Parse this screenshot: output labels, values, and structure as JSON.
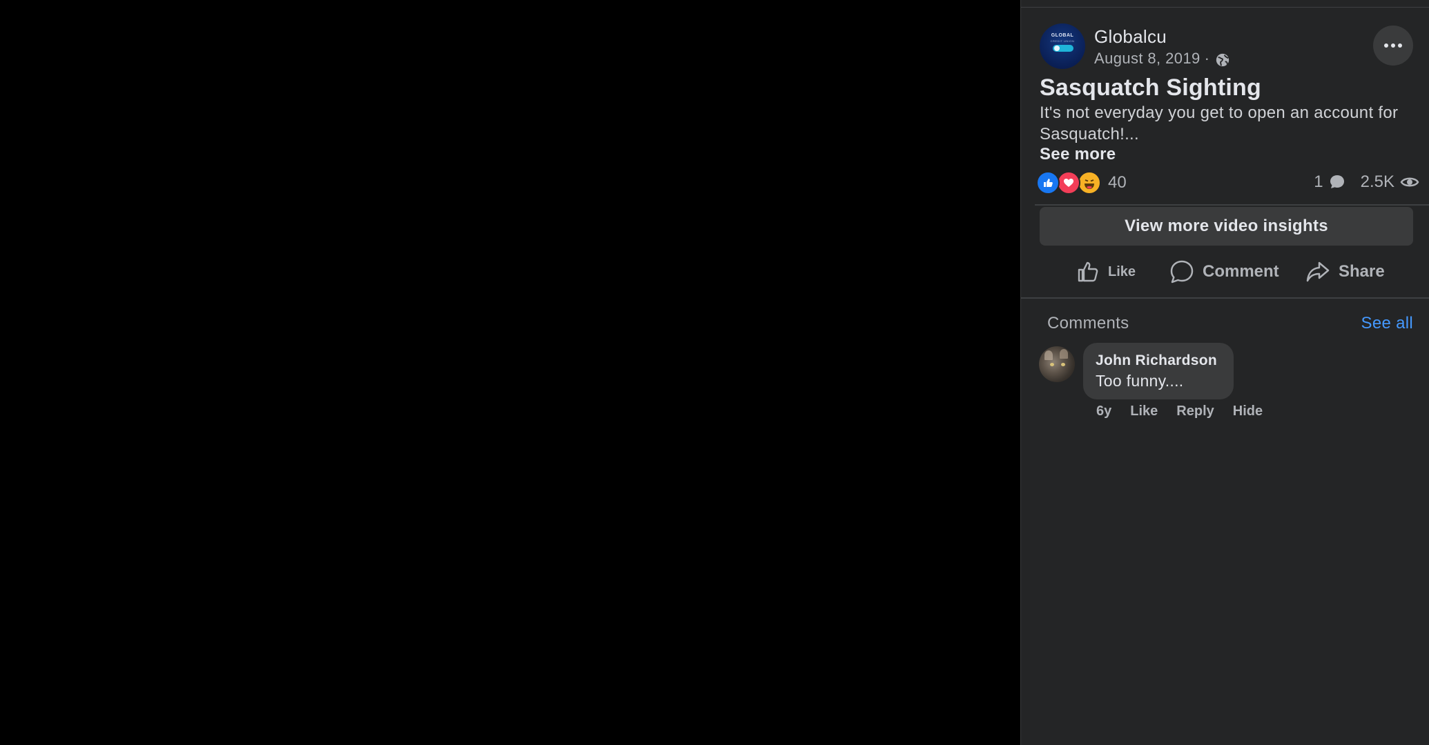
{
  "post": {
    "page_name": "Globalcu",
    "avatar_logo_text": "GLOBAL",
    "avatar_logo_subtext": "CREDIT UNION",
    "date": "August 8, 2019",
    "separator": "·",
    "title": "Sasquatch Sighting",
    "body": "It's not everyday you get to open an account for Sasquatch!...",
    "see_more": "See more"
  },
  "stats": {
    "reaction_count": "40",
    "comment_count": "1",
    "view_count": "2.5K"
  },
  "insights_button": "View more video insights",
  "actions": {
    "like": "Like",
    "comment": "Comment",
    "share": "Share"
  },
  "comments": {
    "heading": "Comments",
    "see_all": "See all",
    "items": [
      {
        "author": "John Richardson",
        "text": "Too funny....",
        "time": "6y",
        "like": "Like",
        "reply": "Reply",
        "hide": "Hide"
      }
    ]
  },
  "colors": {
    "background": "#000000",
    "panel": "#242526",
    "button": "#3a3b3c",
    "link": "#4599ff",
    "like_reaction": "#1877f2",
    "love_reaction": "#f33e58",
    "haha_reaction": "#f7b125"
  },
  "icons": [
    "globe-icon",
    "more-icon",
    "like-reaction-icon",
    "love-reaction-icon",
    "haha-reaction-icon",
    "comment-count-icon",
    "views-eye-icon",
    "like-icon",
    "comment-icon",
    "share-icon"
  ]
}
